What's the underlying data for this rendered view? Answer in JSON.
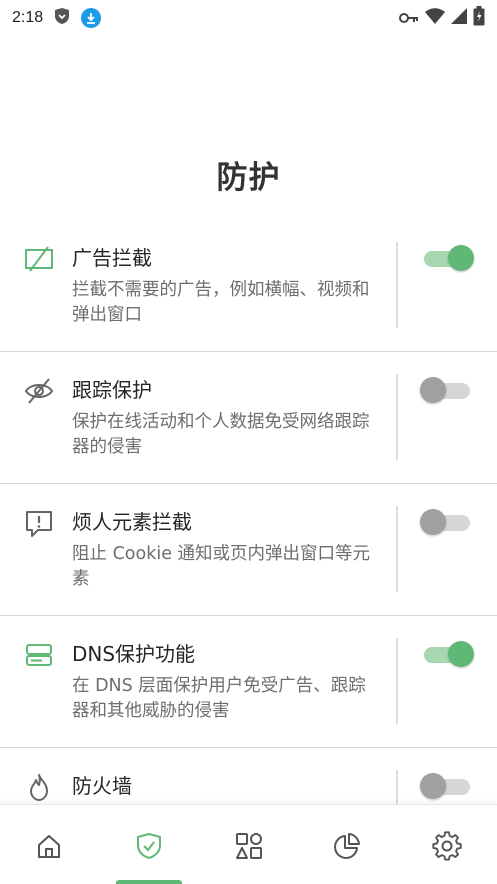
{
  "status_bar": {
    "time": "2:18",
    "icons": [
      "shield-status-icon",
      "download-icon",
      "key-icon",
      "wifi-icon",
      "signal-icon",
      "battery-icon"
    ]
  },
  "page": {
    "title": "防护"
  },
  "colors": {
    "accent": "#5fb875",
    "accent_light": "#a7d8b2",
    "text_primary": "#262626",
    "text_secondary": "#6e6e6e",
    "divider": "#d8d8d8",
    "toggle_off_knob": "#a0a0a0",
    "toggle_off_track": "#d6d6d6"
  },
  "items": [
    {
      "icon": "ad-block-icon",
      "title": "广告拦截",
      "description": "拦截不需要的广告，例如横幅、视频和弹出窗口",
      "enabled": true
    },
    {
      "icon": "eye-slash-icon",
      "title": "跟踪保护",
      "description": "保护在线活动和个人数据免受网络跟踪器的侵害",
      "enabled": false
    },
    {
      "icon": "alert-message-icon",
      "title": "烦人元素拦截",
      "description": "阻止 Cookie 通知或页内弹出窗口等元素",
      "enabled": false
    },
    {
      "icon": "dns-server-icon",
      "title": "DNS保护功能",
      "description": "在 DNS 层面保护用户免受广告、跟踪器和其他威胁的侵害",
      "enabled": true
    },
    {
      "icon": "fire-icon",
      "title": "防火墙",
      "description": "",
      "enabled": false
    }
  ],
  "bottom_nav": {
    "items": [
      "home-icon",
      "shield-check-icon",
      "apps-grid-icon",
      "pie-chart-icon",
      "settings-gear-icon"
    ],
    "active_index": 1
  }
}
